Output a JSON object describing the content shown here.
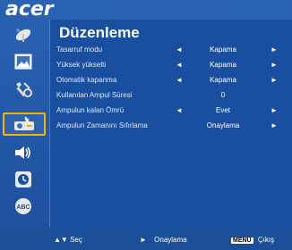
{
  "brand": {
    "name": "acer"
  },
  "menu": {
    "title": "Düzenleme",
    "rows": [
      {
        "label": "Tasarruf modu",
        "value": "Kapama",
        "left_arrow": "◄",
        "right_arrow": "►"
      },
      {
        "label": "Yüksek yükselti",
        "value": "Kapama",
        "left_arrow": "◄",
        "right_arrow": "►"
      },
      {
        "label": "Otomatik kapanma",
        "value": "Kapama",
        "left_arrow": "◄",
        "right_arrow": "►"
      },
      {
        "label": "Kullanılan Ampul Süresi",
        "value": "0",
        "left_arrow": "",
        "right_arrow": ""
      },
      {
        "label": "Ampulun kalan Ömrü",
        "value": "Evet",
        "left_arrow": "◄",
        "right_arrow": "►"
      },
      {
        "label": "Ampulun Zamanını Sıfırlama",
        "value": "Onaylama",
        "left_arrow": "",
        "right_arrow": "►"
      }
    ]
  },
  "sidebar": {
    "items": [
      {
        "icon": "satellite-dish-icon",
        "active": false
      },
      {
        "icon": "picture-icon",
        "active": false
      },
      {
        "icon": "settings-tools-icon",
        "active": false
      },
      {
        "icon": "projector-icon",
        "active": true
      },
      {
        "icon": "speaker-icon",
        "active": false
      },
      {
        "icon": "clock-icon",
        "active": false
      },
      {
        "icon": "language-abc-icon",
        "active": false
      }
    ]
  },
  "footer": {
    "select_arrows": "▲▼",
    "select_label": "Seç",
    "confirm_arrow": "►",
    "confirm_label": "Onaylama",
    "menu_key": "MENU",
    "exit_label": "Çıkış"
  },
  "colors": {
    "accent": "#f5b400",
    "background": "#1b4f9a",
    "text": "#ffffff"
  }
}
